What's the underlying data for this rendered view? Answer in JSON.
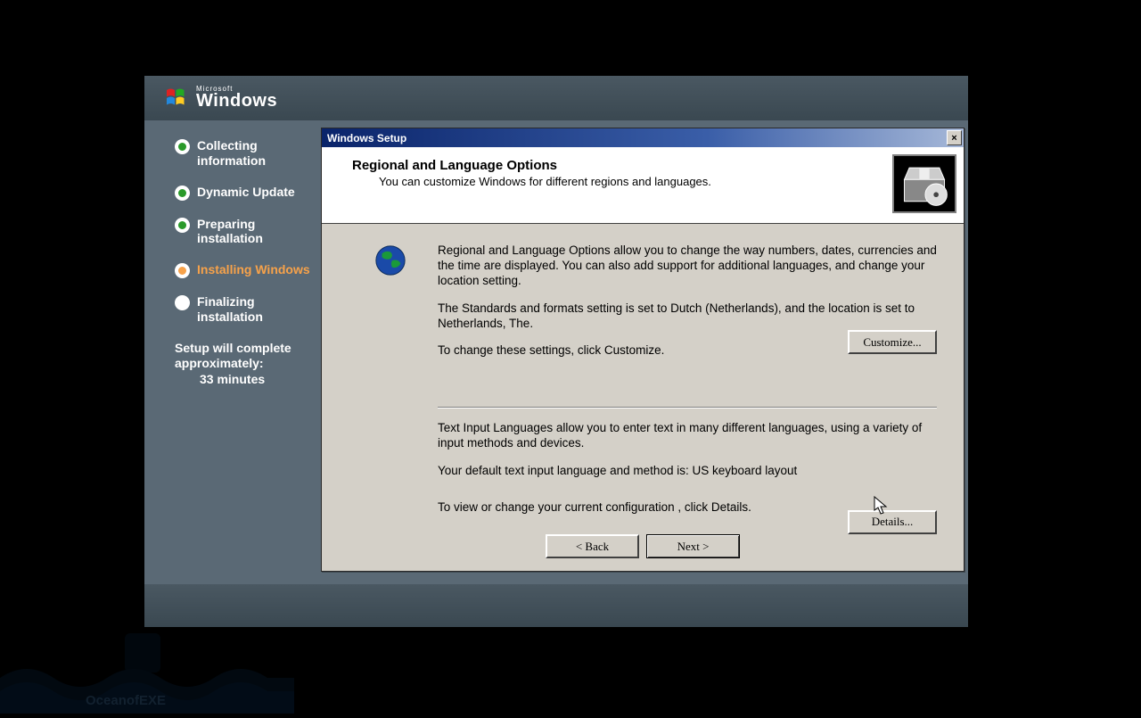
{
  "brand": {
    "small": "Microsoft",
    "big": "Windows"
  },
  "sidebar": {
    "steps": [
      {
        "label": "Collecting information",
        "state": "done"
      },
      {
        "label": "Dynamic Update",
        "state": "done"
      },
      {
        "label": "Preparing installation",
        "state": "done"
      },
      {
        "label": "Installing Windows",
        "state": "current"
      },
      {
        "label": "Finalizing installation",
        "state": "pending"
      }
    ],
    "complete_label": "Setup will complete approximately:",
    "complete_time": "33 minutes"
  },
  "wizard": {
    "titlebar": "Windows Setup",
    "close_label": "×",
    "title": "Regional and Language Options",
    "subtitle": "You can customize Windows for different regions and languages.",
    "para1": "Regional and Language Options allow you to change the way numbers, dates, currencies and the time are displayed. You can also add support for additional languages, and change your location setting.",
    "para2": "The Standards and formats setting is set to Dutch (Netherlands), and the location is set to Netherlands, The.",
    "para3": "To change these settings, click Customize.",
    "customize_label": "Customize...",
    "para4": "Text Input Languages allow you to enter text in many different languages, using a variety of input methods and devices.",
    "para5": "Your default text input language and method is: US keyboard layout",
    "para6": "To view or change your current configuration , click Details.",
    "details_label": "Details...",
    "back_label": "< Back",
    "next_label": "Next >"
  },
  "watermark": {
    "text": "OceanofEXE"
  }
}
